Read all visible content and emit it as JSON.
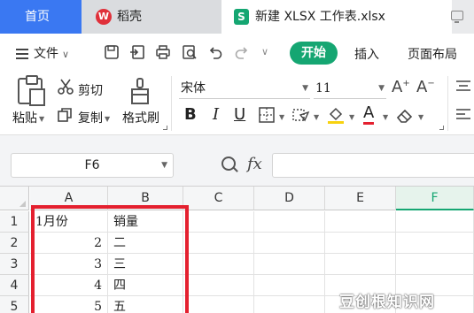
{
  "tabs": {
    "home": "首页",
    "shell": "稻壳",
    "shell_logo": "W",
    "file": "新建 XLSX 工作表.xlsx",
    "file_logo": "S"
  },
  "menu": {
    "file": "文件",
    "start": "开始",
    "insert": "插入",
    "page_layout": "页面布局"
  },
  "ribbon": {
    "cut": "剪切",
    "paste": "粘贴",
    "copy": "复制",
    "format_painter": "格式刷",
    "font_name": "宋体",
    "font_size": "11",
    "bold": "B",
    "italic": "I",
    "underline": "U",
    "font_color_letter": "A"
  },
  "formula_bar": {
    "name_box": "F6",
    "fx": "fx"
  },
  "sheet": {
    "columns": [
      "A",
      "B",
      "C",
      "D",
      "E",
      "F"
    ],
    "selected_column": "F",
    "rows": [
      {
        "num": "1",
        "a": "1月份",
        "b": "销量"
      },
      {
        "num": "2",
        "a": "2",
        "b": "二"
      },
      {
        "num": "3",
        "a": "3",
        "b": "三"
      },
      {
        "num": "4",
        "a": "4",
        "b": "四"
      },
      {
        "num": "5",
        "a": "5",
        "b": "五"
      }
    ]
  },
  "watermark": "豆创根知识网",
  "colors": {
    "accent_green": "#15a672",
    "home_tab_blue": "#3a78f2",
    "highlight_red": "#e4202f"
  }
}
